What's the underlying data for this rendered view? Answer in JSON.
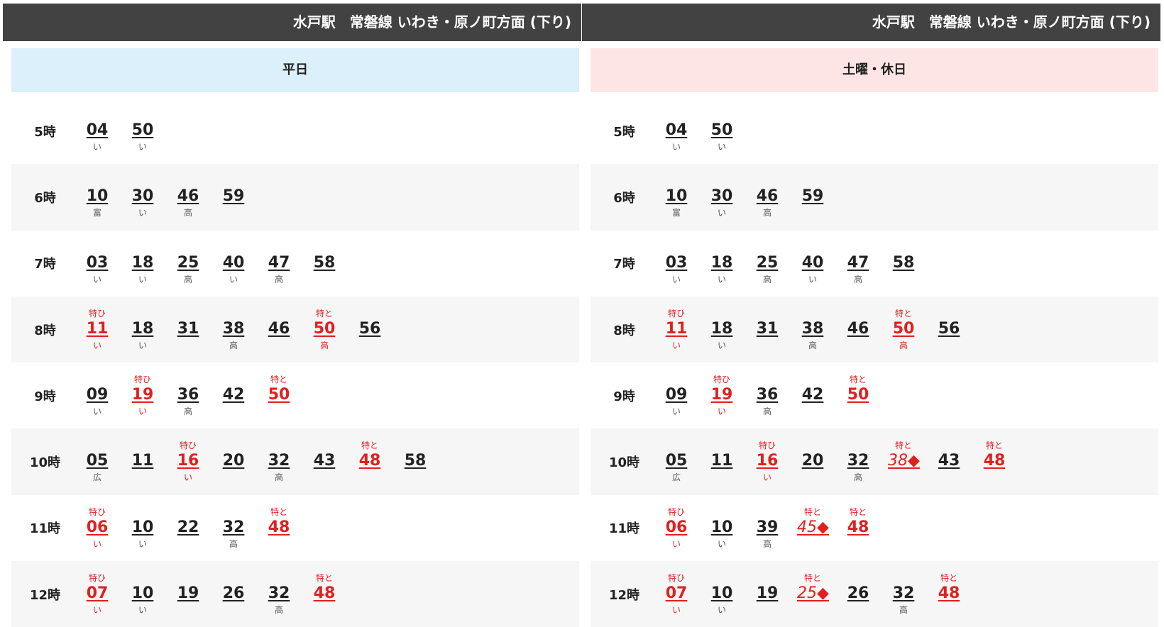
{
  "panels": [
    {
      "title": "水戸駅　常磐線 いわき・原ノ町方面 (下り)",
      "day_type": "平日",
      "day_style": "weekday",
      "rows": [
        {
          "hour": "5時",
          "deps": [
            {
              "min": "04",
              "dest": "い"
            },
            {
              "min": "50",
              "dest": "い"
            }
          ]
        },
        {
          "hour": "6時",
          "deps": [
            {
              "min": "10",
              "dest": "富"
            },
            {
              "min": "30",
              "dest": "い"
            },
            {
              "min": "46",
              "dest": "高"
            },
            {
              "min": "59"
            }
          ]
        },
        {
          "hour": "7時",
          "deps": [
            {
              "min": "03",
              "dest": "い"
            },
            {
              "min": "18",
              "dest": "い"
            },
            {
              "min": "25",
              "dest": "高"
            },
            {
              "min": "40",
              "dest": "い"
            },
            {
              "min": "47",
              "dest": "高"
            },
            {
              "min": "58"
            }
          ]
        },
        {
          "hour": "8時",
          "deps": [
            {
              "min": "11",
              "mark": "特ひ",
              "dest": "い",
              "red": true
            },
            {
              "min": "18",
              "dest": "い"
            },
            {
              "min": "31"
            },
            {
              "min": "38",
              "dest": "高"
            },
            {
              "min": "46"
            },
            {
              "min": "50",
              "mark": "特と",
              "dest": "高",
              "red": true
            },
            {
              "min": "56"
            }
          ]
        },
        {
          "hour": "9時",
          "deps": [
            {
              "min": "09",
              "dest": "い"
            },
            {
              "min": "19",
              "mark": "特ひ",
              "dest": "い",
              "red": true
            },
            {
              "min": "36",
              "dest": "高"
            },
            {
              "min": "42"
            },
            {
              "min": "50",
              "mark": "特と",
              "red": true
            }
          ]
        },
        {
          "hour": "10時",
          "deps": [
            {
              "min": "05",
              "dest": "広"
            },
            {
              "min": "11"
            },
            {
              "min": "16",
              "mark": "特ひ",
              "dest": "い",
              "red": true
            },
            {
              "min": "20"
            },
            {
              "min": "32",
              "dest": "高"
            },
            {
              "min": "43"
            },
            {
              "min": "48",
              "mark": "特と",
              "red": true
            },
            {
              "min": "58"
            }
          ]
        },
        {
          "hour": "11時",
          "deps": [
            {
              "min": "06",
              "mark": "特ひ",
              "dest": "い",
              "red": true
            },
            {
              "min": "10",
              "dest": "い"
            },
            {
              "min": "22"
            },
            {
              "min": "32",
              "dest": "高"
            },
            {
              "min": "48",
              "mark": "特と",
              "red": true
            }
          ]
        },
        {
          "hour": "12時",
          "deps": [
            {
              "min": "07",
              "mark": "特ひ",
              "dest": "い",
              "red": true
            },
            {
              "min": "10",
              "dest": "い"
            },
            {
              "min": "19"
            },
            {
              "min": "26"
            },
            {
              "min": "32",
              "dest": "高"
            },
            {
              "min": "48",
              "mark": "特と",
              "red": true
            }
          ]
        }
      ]
    },
    {
      "title": "水戸駅　常磐線 いわき・原ノ町方面 (下り)",
      "day_type": "土曜・休日",
      "day_style": "holiday",
      "rows": [
        {
          "hour": "5時",
          "deps": [
            {
              "min": "04",
              "dest": "い"
            },
            {
              "min": "50",
              "dest": "い"
            }
          ]
        },
        {
          "hour": "6時",
          "deps": [
            {
              "min": "10",
              "dest": "富"
            },
            {
              "min": "30",
              "dest": "い"
            },
            {
              "min": "46",
              "dest": "高"
            },
            {
              "min": "59"
            }
          ]
        },
        {
          "hour": "7時",
          "deps": [
            {
              "min": "03",
              "dest": "い"
            },
            {
              "min": "18",
              "dest": "い"
            },
            {
              "min": "25",
              "dest": "高"
            },
            {
              "min": "40",
              "dest": "い"
            },
            {
              "min": "47",
              "dest": "高"
            },
            {
              "min": "58"
            }
          ]
        },
        {
          "hour": "8時",
          "deps": [
            {
              "min": "11",
              "mark": "特ひ",
              "dest": "い",
              "red": true
            },
            {
              "min": "18",
              "dest": "い"
            },
            {
              "min": "31"
            },
            {
              "min": "38",
              "dest": "高"
            },
            {
              "min": "46"
            },
            {
              "min": "50",
              "mark": "特と",
              "dest": "高",
              "red": true
            },
            {
              "min": "56"
            }
          ]
        },
        {
          "hour": "9時",
          "deps": [
            {
              "min": "09",
              "dest": "い"
            },
            {
              "min": "19",
              "mark": "特ひ",
              "dest": "い",
              "red": true
            },
            {
              "min": "36",
              "dest": "高"
            },
            {
              "min": "42"
            },
            {
              "min": "50",
              "mark": "特と",
              "red": true
            }
          ]
        },
        {
          "hour": "10時",
          "deps": [
            {
              "min": "05",
              "dest": "広"
            },
            {
              "min": "11"
            },
            {
              "min": "16",
              "mark": "特ひ",
              "dest": "い",
              "red": true
            },
            {
              "min": "20"
            },
            {
              "min": "32",
              "dest": "高"
            },
            {
              "min": "38◆",
              "mark": "特と",
              "red": true,
              "special": true
            },
            {
              "min": "43"
            },
            {
              "min": "48",
              "mark": "特と",
              "red": true
            }
          ]
        },
        {
          "hour": "11時",
          "deps": [
            {
              "min": "06",
              "mark": "特ひ",
              "dest": "い",
              "red": true
            },
            {
              "min": "10",
              "dest": "い"
            },
            {
              "min": "39",
              "dest": "高"
            },
            {
              "min": "45◆",
              "mark": "特と",
              "red": true,
              "special": true
            },
            {
              "min": "48",
              "mark": "特と",
              "red": true
            }
          ]
        },
        {
          "hour": "12時",
          "deps": [
            {
              "min": "07",
              "mark": "特ひ",
              "dest": "い",
              "red": true
            },
            {
              "min": "10",
              "dest": "い"
            },
            {
              "min": "19"
            },
            {
              "min": "25◆",
              "mark": "特と",
              "red": true,
              "special": true
            },
            {
              "min": "26"
            },
            {
              "min": "32",
              "dest": "高"
            },
            {
              "min": "48",
              "mark": "特と",
              "red": true
            }
          ]
        }
      ]
    }
  ]
}
